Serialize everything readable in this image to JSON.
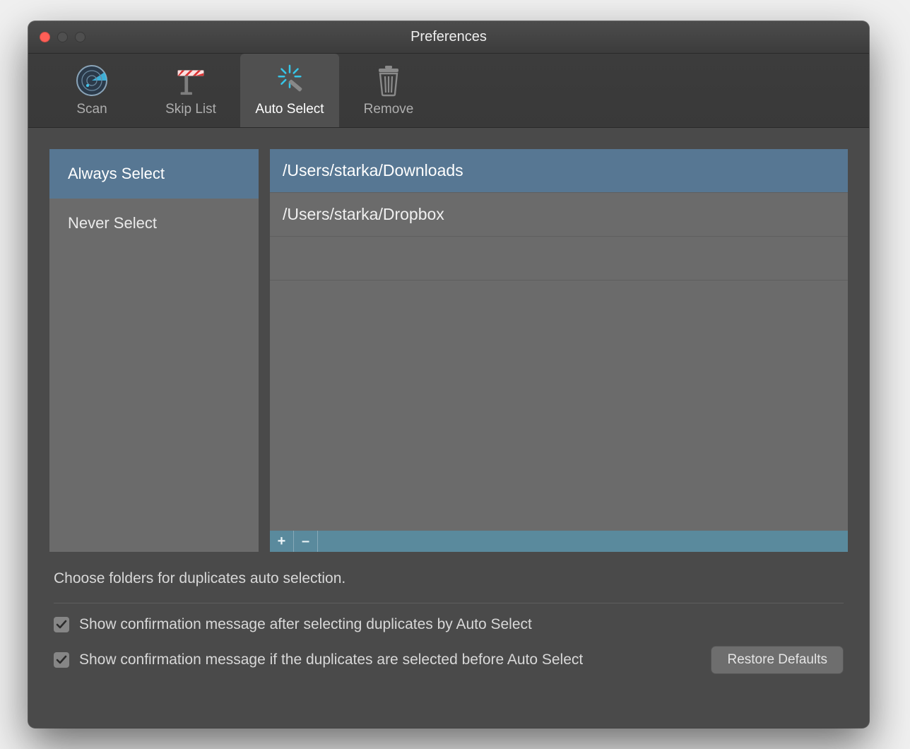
{
  "window": {
    "title": "Preferences"
  },
  "toolbar": {
    "items": [
      {
        "id": "scan",
        "label": "Scan",
        "icon": "radar-icon"
      },
      {
        "id": "skip",
        "label": "Skip List",
        "icon": "barrier-icon"
      },
      {
        "id": "autoselect",
        "label": "Auto Select",
        "icon": "wand-icon"
      },
      {
        "id": "remove",
        "label": "Remove",
        "icon": "trash-icon"
      }
    ],
    "active_index": 2
  },
  "sidebar": {
    "items": [
      {
        "label": "Always Select",
        "selected": true
      },
      {
        "label": "Never Select",
        "selected": false
      }
    ]
  },
  "paths": {
    "rows": [
      {
        "path": "/Users/starka/Downloads",
        "selected": true
      },
      {
        "path": "/Users/starka/Dropbox",
        "selected": false
      },
      {
        "path": "",
        "selected": false
      }
    ],
    "add_label": "+",
    "remove_label": "–"
  },
  "description": "Choose folders for duplicates auto selection.",
  "checkboxes": [
    {
      "checked": true,
      "label": "Show confirmation message after selecting duplicates by Auto Select"
    },
    {
      "checked": true,
      "label": "Show confirmation message if the duplicates are selected before Auto Select"
    }
  ],
  "restore_label": "Restore Defaults"
}
